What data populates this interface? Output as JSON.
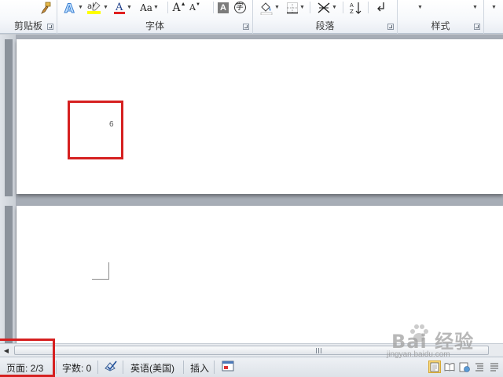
{
  "ribbon": {
    "groups": {
      "clipboard": "剪贴板",
      "font": "字体",
      "paragraph": "段落",
      "styles": "样式"
    },
    "font_tools": {
      "grow_font": "A",
      "shrink_font": "A",
      "change_case": "Aa",
      "clear_formatting": "A",
      "phonetic_guide": "字"
    },
    "colors": {
      "font_color": "#e02020",
      "highlight_color": "#ffff00",
      "highlight_box": "#d62020"
    },
    "icons": [
      "format-painter-icon",
      "text-effects-icon",
      "highlight-icon",
      "font-color-icon",
      "change-case-icon",
      "grow-font-icon",
      "shrink-font-icon",
      "clear-formatting-icon",
      "phonetic-guide-icon",
      "shading-icon",
      "borders-icon",
      "chinese-layout-icon",
      "sort-icon",
      "show-marks-icon"
    ]
  },
  "document": {
    "page1_number": "6"
  },
  "statusbar": {
    "page": "页面: 2/3",
    "word_count": "字数: 0",
    "language": "英语(美国)",
    "mode": "插入"
  },
  "watermark": {
    "main": "Bai 经验",
    "sub": "jingyan.baidu.com"
  }
}
